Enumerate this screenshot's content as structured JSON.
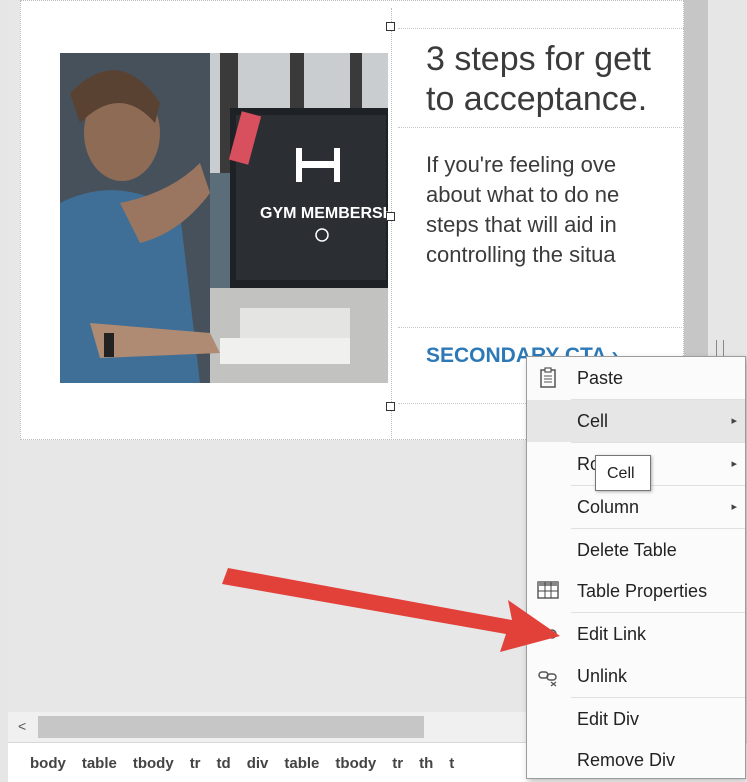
{
  "email": {
    "headline": "3 steps for gett\nto acceptance.",
    "body": "If you're feeling ove\nabout what to do ne\nsteps that will aid in\ncontrolling the situa",
    "cta": "SECONDARY CTA ›",
    "image_text": "GYM MEMBERSHI"
  },
  "context_menu": {
    "items": [
      {
        "label": "Paste",
        "icon": "clipboard-icon",
        "submenu": false
      },
      {
        "label": "Cell",
        "icon": "",
        "submenu": true
      },
      {
        "label": "Row",
        "icon": "",
        "submenu": true
      },
      {
        "label": "Column",
        "icon": "",
        "submenu": true
      },
      {
        "label": "Delete Table",
        "icon": "",
        "submenu": false
      },
      {
        "label": "Table Properties",
        "icon": "table-icon",
        "submenu": false
      },
      {
        "label": "Edit Link",
        "icon": "link-icon",
        "submenu": false
      },
      {
        "label": "Unlink",
        "icon": "unlink-icon",
        "submenu": false
      },
      {
        "label": "Edit Div",
        "icon": "",
        "submenu": false
      },
      {
        "label": "Remove Div",
        "icon": "",
        "submenu": false
      }
    ],
    "submenu_arrow": "▸"
  },
  "tooltip": {
    "text": "Cell"
  },
  "breadcrumb": [
    "body",
    "table",
    "tbody",
    "tr",
    "td",
    "div",
    "table",
    "tbody",
    "tr",
    "th",
    "t"
  ],
  "scrollbar": {
    "left_arrow": "<"
  },
  "colors": {
    "cta": "#2d79b8",
    "arrow": "#e2413a"
  }
}
